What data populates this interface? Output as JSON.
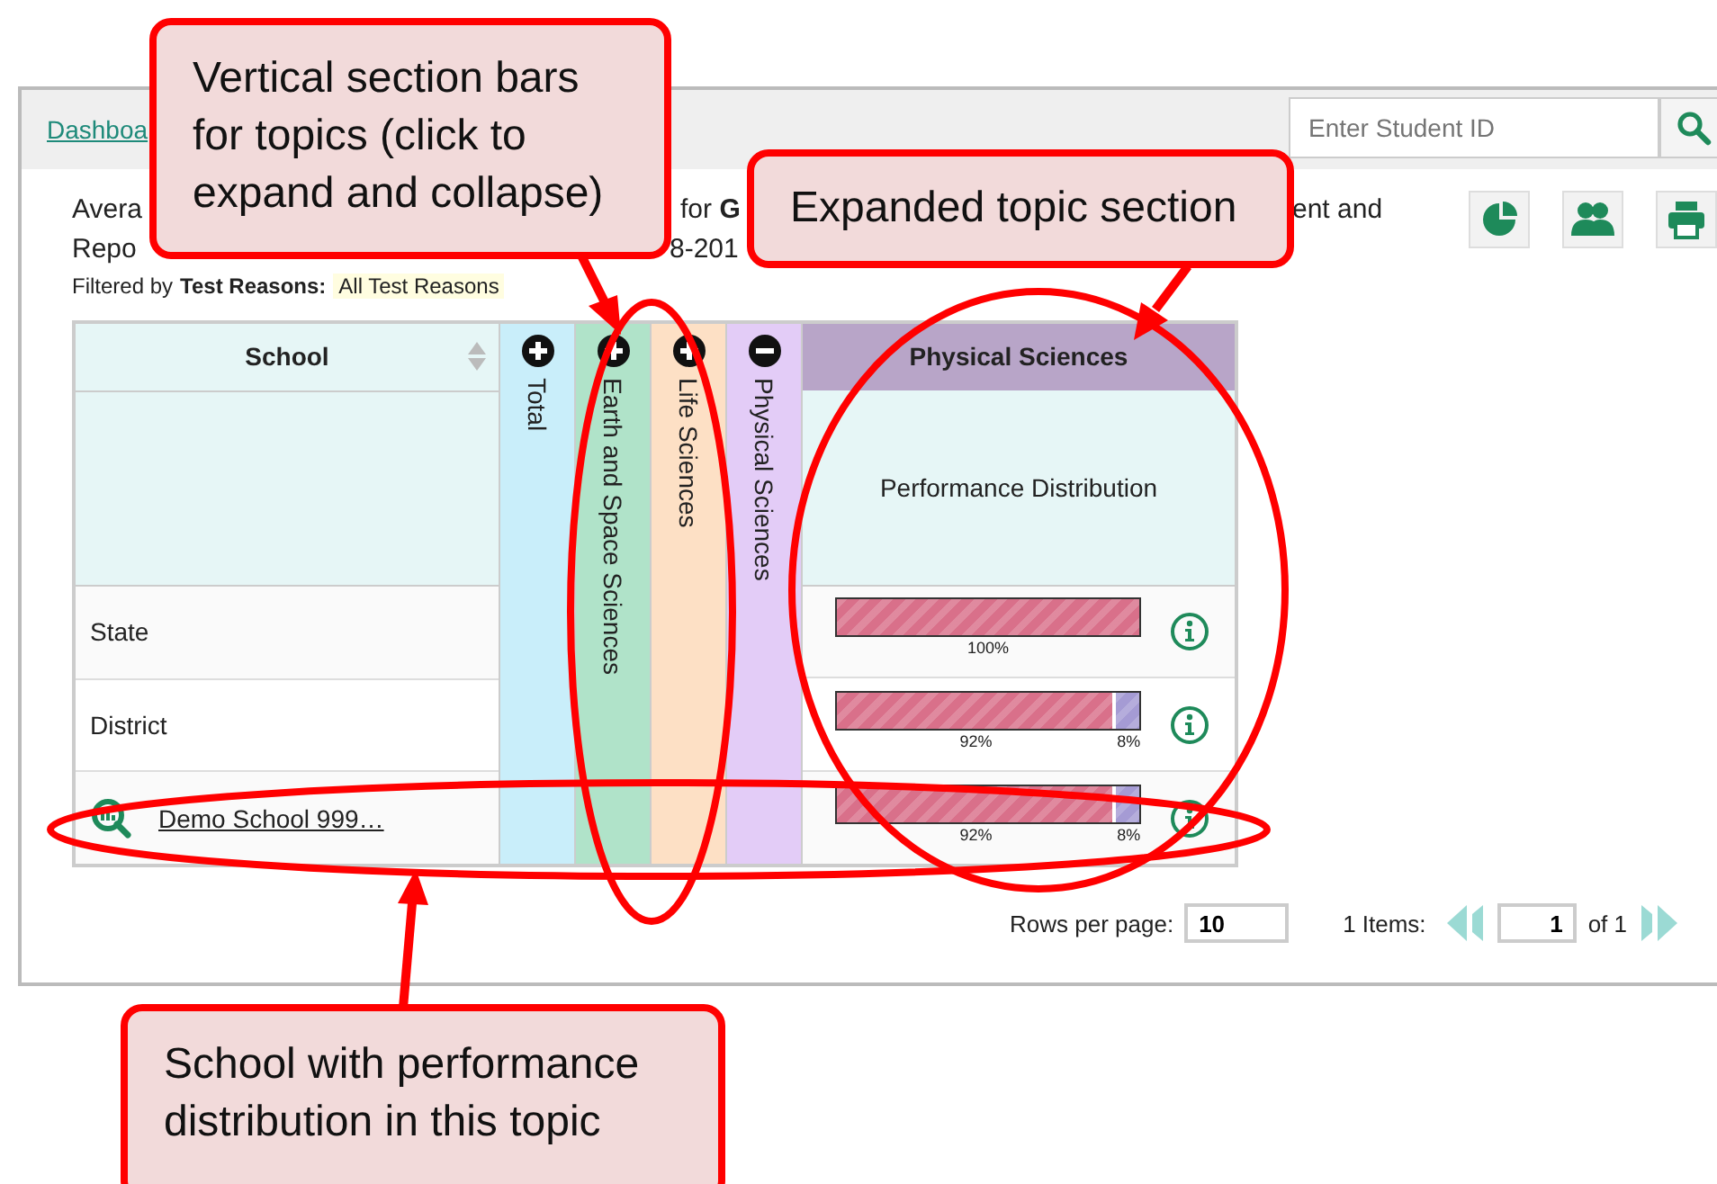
{
  "topbar": {
    "link": "Dashboa",
    "search": {
      "placeholder": "Enter Student ID"
    }
  },
  "heading": {
    "line_1": [
      "Avera",
      "for **G**",
      "ent and"
    ],
    "line_2": [
      "Repo",
      "8-201"
    ]
  },
  "filter": {
    "label": "Filtered by",
    "key": "Test Reasons:",
    "value": "All Test Reasons"
  },
  "table": {
    "school_column": "School",
    "topics": [
      {
        "label": "Total",
        "color": "#c9eefa",
        "expanded": false
      },
      {
        "label": "Earth and Space Sciences",
        "color": "#b0e3c9",
        "expanded": false
      },
      {
        "label": "Life Sciences",
        "color": "#fde0c5",
        "expanded": false
      },
      {
        "label": "Physical Sciences",
        "color": "#e3ccf7",
        "expanded": true
      }
    ],
    "expanded_section": {
      "title": "Physical Sciences",
      "subheader": "Performance Distribution"
    },
    "rows": [
      {
        "kind": "aggregate",
        "name": "State",
        "segments": [
          {
            "level": 1,
            "label": "100%",
            "color": "#d9708a"
          }
        ]
      },
      {
        "kind": "aggregate",
        "name": "District",
        "segments": [
          {
            "level": 0.92,
            "label": "92%",
            "color": "#d9708a"
          },
          {
            "level": 0.08,
            "label": "8%",
            "color": "#a59bd4"
          }
        ]
      },
      {
        "kind": "school",
        "name": "Demo School 999…",
        "segments": [
          {
            "level": 0.92,
            "label": "92%",
            "color": "#d9708a"
          },
          {
            "level": 0.08,
            "label": "8%",
            "color": "#a59bd4"
          }
        ]
      }
    ]
  },
  "pagination": {
    "rows_label": "Rows per page:",
    "rows_value": "10",
    "items": "1 Items:",
    "page": "1",
    "of": "of 1"
  },
  "annotations": [
    {
      "text": "Vertical section bars for topics (click to expand and collapse)"
    },
    {
      "text": "Expanded topic section"
    },
    {
      "text": "School with performance distribution in this topic"
    }
  ]
}
